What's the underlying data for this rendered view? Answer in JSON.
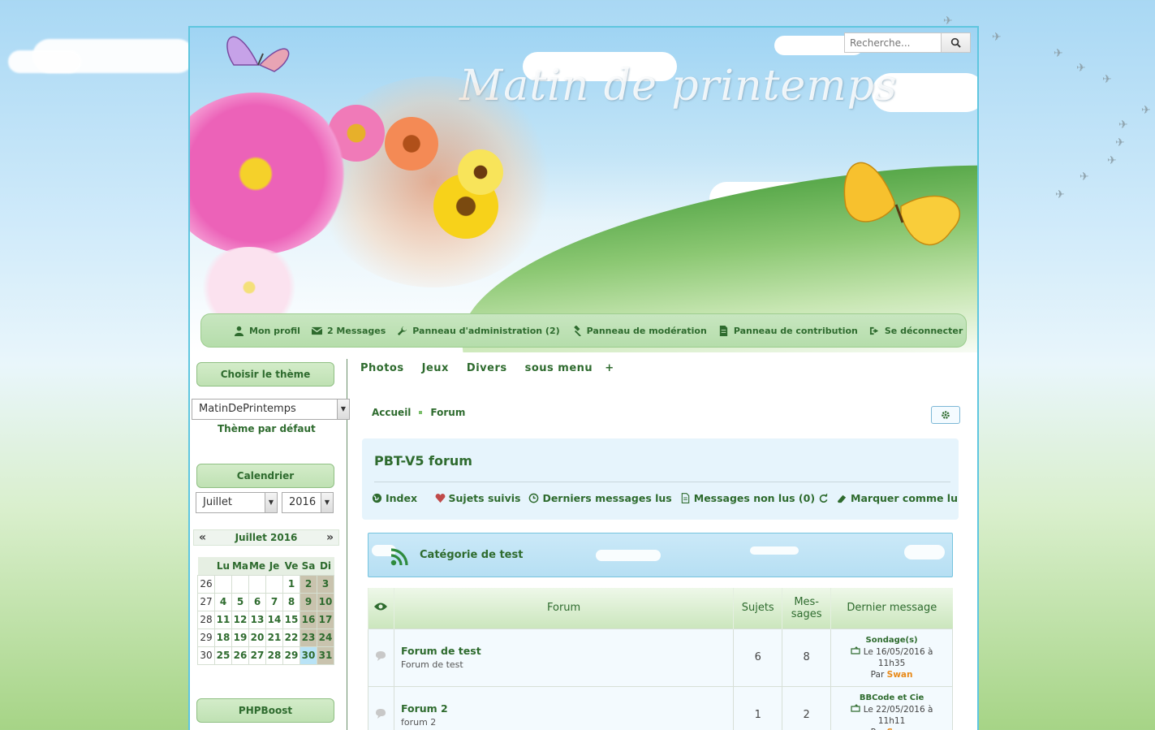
{
  "site": {
    "title": "Matin de printemps",
    "search_placeholder": "Recherche..."
  },
  "userbar": [
    {
      "icon": "user-icon",
      "label": "Mon profil"
    },
    {
      "icon": "envelope-icon",
      "label": "2 Messages"
    },
    {
      "icon": "wrench-icon",
      "label": "Panneau d'administration (2)"
    },
    {
      "icon": "gavel-icon",
      "label": "Panneau de modération"
    },
    {
      "icon": "file-icon",
      "label": "Panneau de contribution"
    },
    {
      "icon": "sign-out-icon",
      "label": "Se déconnecter"
    }
  ],
  "theme_menu": {
    "title": "Choisir le thème",
    "selected": "MatinDePrintemps",
    "default_link": "Thème par défaut"
  },
  "calendar": {
    "title": "Calendrier",
    "month_select": "Juillet",
    "year_select": "2016",
    "header": "Juillet 2016",
    "prev": "«",
    "next": "»",
    "days": [
      "Lu",
      "Ma",
      "Me",
      "Je",
      "Ve",
      "Sa",
      "Di"
    ],
    "weeks": [
      {
        "wk": "26",
        "d": [
          "",
          "",
          "",
          "",
          "1",
          "2",
          "3"
        ]
      },
      {
        "wk": "27",
        "d": [
          "4",
          "5",
          "6",
          "7",
          "8",
          "9",
          "10"
        ]
      },
      {
        "wk": "28",
        "d": [
          "11",
          "12",
          "13",
          "14",
          "15",
          "16",
          "17"
        ]
      },
      {
        "wk": "29",
        "d": [
          "18",
          "19",
          "20",
          "21",
          "22",
          "23",
          "24"
        ]
      },
      {
        "wk": "30",
        "d": [
          "25",
          "26",
          "27",
          "28",
          "29",
          "30",
          "31"
        ]
      }
    ],
    "today": "30"
  },
  "phpboost_menu": {
    "title": "PHPBoost"
  },
  "topnav": [
    "Photos",
    "Jeux",
    "Divers",
    "sous menu",
    "+"
  ],
  "breadcrumb": [
    "Accueil",
    "Forum"
  ],
  "forum": {
    "title": "PBT-V5 forum",
    "links": [
      {
        "icon": "globe-icon",
        "label": "Index"
      },
      {
        "icon": "heart-icon",
        "label": "Sujets suivis"
      },
      {
        "icon": "clock-icon",
        "label": "Derniers messages lus"
      },
      {
        "icon": "file-text-icon",
        "label": "Messages non lus (0)"
      },
      {
        "icon": "refresh-icon",
        "label": ""
      },
      {
        "icon": "eraser-icon",
        "label": "Marquer comme lu"
      }
    ]
  },
  "category": {
    "title": "Catégorie de test"
  },
  "table": {
    "headers": {
      "forum": "Forum",
      "topics": "Sujets",
      "messages_1": "Mes-",
      "messages_2": "sages",
      "last": "Dernier message"
    },
    "rows": [
      {
        "name": "Forum de test",
        "desc": "Forum de test",
        "topics": "6",
        "messages": "8",
        "last_title": "Sondage(s)",
        "last_date": "Le 16/05/2016 à",
        "last_time": "11h35",
        "last_by_prefix": "Par",
        "last_by": "Swan"
      },
      {
        "name": "Forum 2",
        "desc": "forum 2",
        "topics": "1",
        "messages": "2",
        "last_title": "BBCode et Cie",
        "last_date": "Le 22/05/2016 à",
        "last_time": "11h11",
        "last_by_prefix": "Par",
        "last_by": "Swan"
      }
    ]
  },
  "colors": {
    "accent_green": "#2e6b2e",
    "sky": "#a9d8f4",
    "border_blue": "#5fc6df",
    "author_orange": "#e88a1a"
  }
}
